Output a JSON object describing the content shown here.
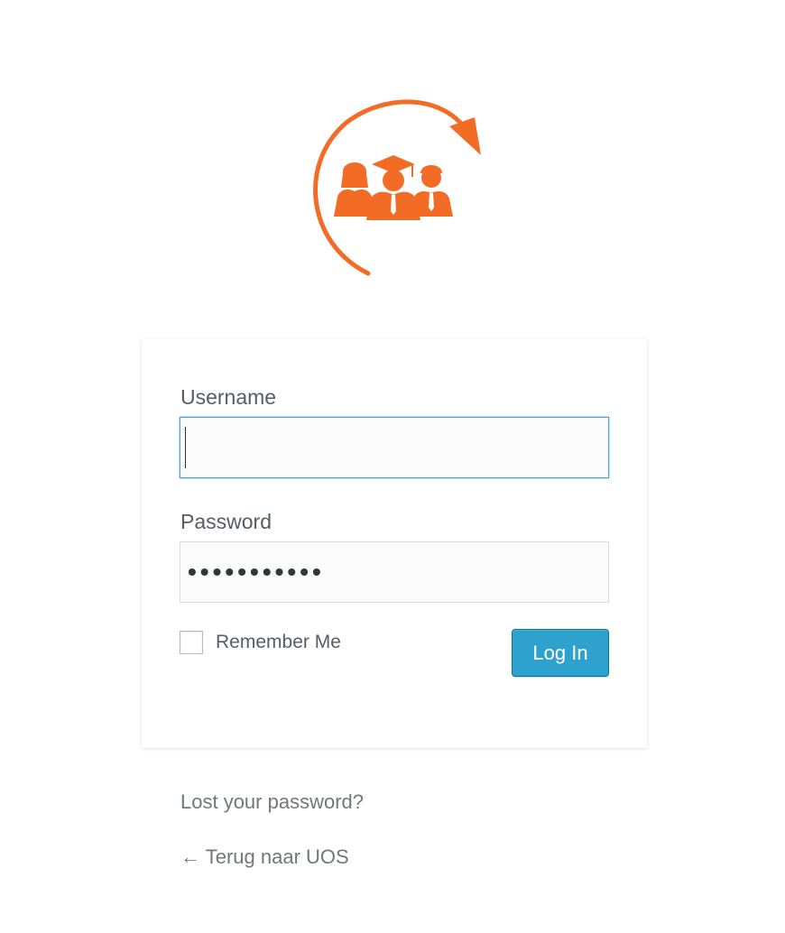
{
  "brand": {
    "logo_icon": "graduates-arrow-icon",
    "accent_color": "#f26c26"
  },
  "form": {
    "username_label": "Username",
    "username_value": "",
    "password_label": "Password",
    "password_value": "•••••••••••",
    "remember_label": "Remember Me",
    "remember_checked": false,
    "submit_label": "Log In",
    "submit_color": "#2ea2cc"
  },
  "links": {
    "lost_password": "Lost your password?",
    "back_arrow": "←",
    "back_label": "Terug naar UOS"
  }
}
